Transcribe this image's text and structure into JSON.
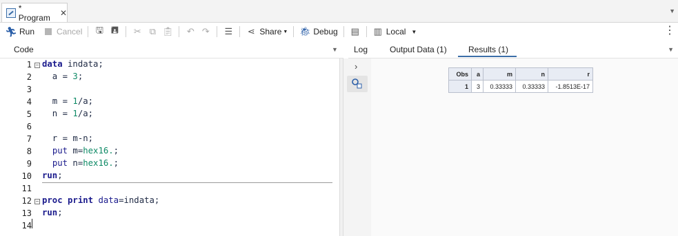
{
  "tab": {
    "title": "* Program"
  },
  "toolbar": {
    "run_label": "Run",
    "cancel_label": "Cancel",
    "share_label": "Share",
    "debug_label": "Debug",
    "server_label": "Local"
  },
  "panes": {
    "code_title": "Code",
    "results_tabs": [
      {
        "label": "Log"
      },
      {
        "label": "Output Data (1)"
      },
      {
        "label": "Results (1)"
      }
    ]
  },
  "editor": {
    "line_numbers": [
      "1",
      "2",
      "3",
      "4",
      "5",
      "6",
      "7",
      "8",
      "9",
      "10",
      "11",
      "12",
      "13",
      "14"
    ]
  },
  "results_table": {
    "headers": [
      "Obs",
      "a",
      "m",
      "n",
      "r"
    ],
    "rows": [
      [
        "1",
        "3",
        "0.33333",
        "0.33333",
        "-1.8513E-17"
      ]
    ]
  }
}
